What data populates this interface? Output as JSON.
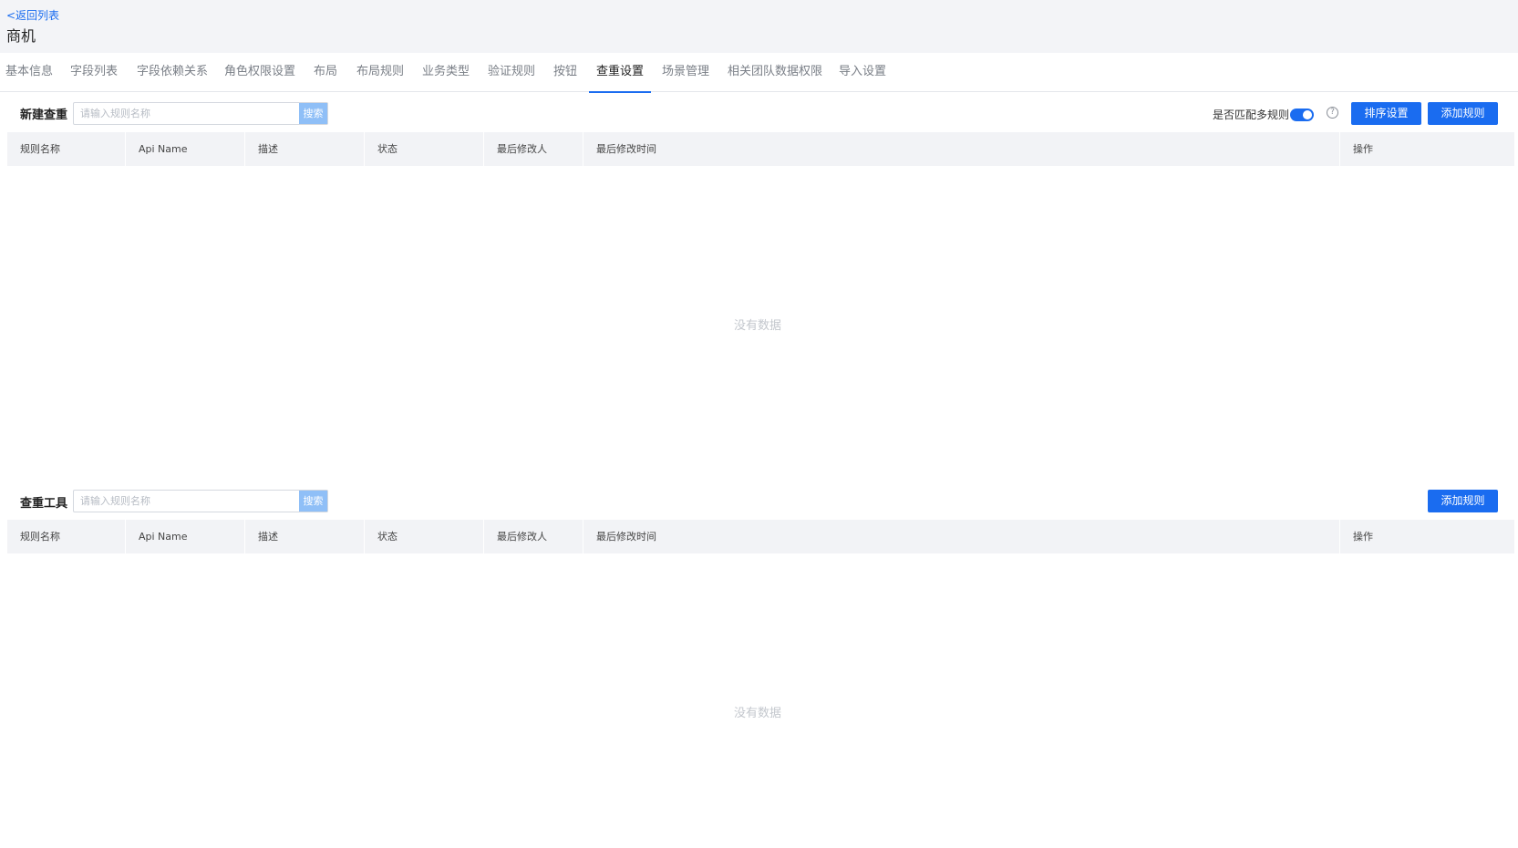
{
  "header": {
    "back_label": "<返回列表",
    "title": "商机"
  },
  "tabs": [
    {
      "label": "基本信息"
    },
    {
      "label": "字段列表"
    },
    {
      "label": "字段依赖关系"
    },
    {
      "label": "角色权限设置"
    },
    {
      "label": "布局"
    },
    {
      "label": "布局规则"
    },
    {
      "label": "业务类型"
    },
    {
      "label": "验证规则"
    },
    {
      "label": "按钮"
    },
    {
      "label": "查重设置",
      "active": true
    },
    {
      "label": "场景管理"
    },
    {
      "label": "相关团队数据权限"
    },
    {
      "label": "导入设置"
    }
  ],
  "dedupe_section": {
    "title": "新建查重",
    "search_placeholder": "请输入规则名称",
    "search_button": "搜索",
    "multi_match_label": "是否匹配多规则",
    "multi_match_enabled": true,
    "help_icon": "question-circle-icon",
    "sort_button": "排序设置",
    "add_button": "添加规则",
    "columns": [
      "规则名称",
      "Api Name",
      "描述",
      "状态",
      "最后修改人",
      "最后修改时间",
      "操作"
    ],
    "empty_text": "没有数据"
  },
  "tool_section": {
    "title": "查重工具",
    "search_placeholder": "请输入规则名称",
    "search_button": "搜索",
    "add_button": "添加规则",
    "columns": [
      "规则名称",
      "Api Name",
      "描述",
      "状态",
      "最后修改人",
      "最后修改时间",
      "操作"
    ],
    "empty_text": "没有数据"
  },
  "colors": {
    "primary": "#1a6cf0",
    "search_button": "#8fbff7",
    "header_bg": "#f3f4f7",
    "table_head_bg": "#f2f3f6"
  }
}
